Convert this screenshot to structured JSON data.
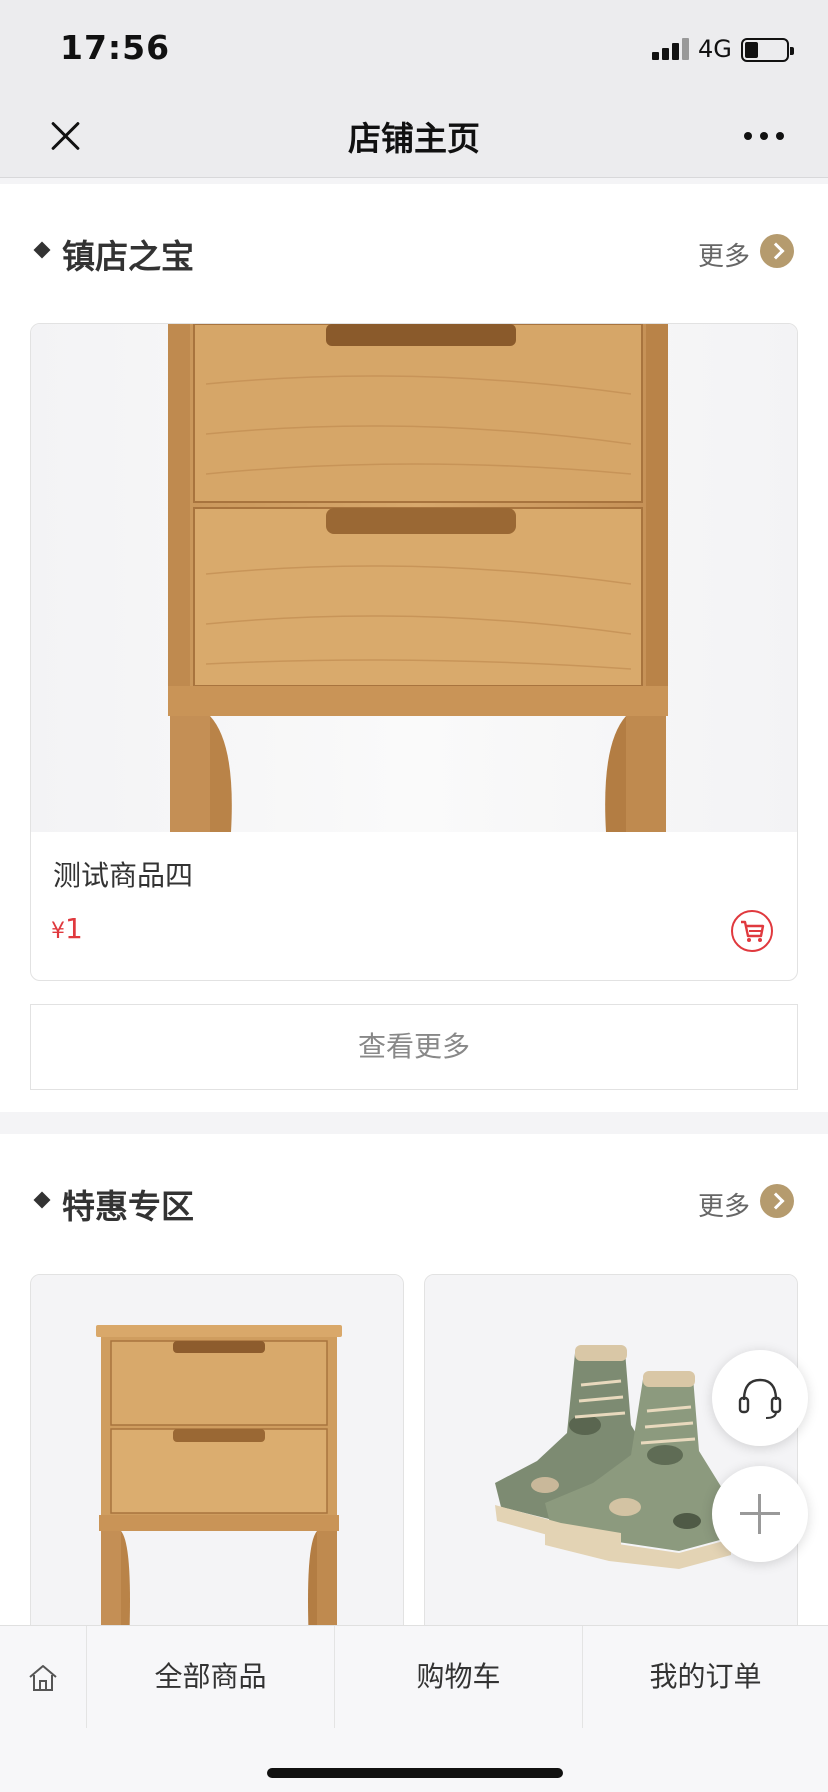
{
  "status_bar": {
    "time": "17:56",
    "network": "4G"
  },
  "nav": {
    "title": "店铺主页"
  },
  "featured": {
    "title": "镇店之宝",
    "more_label": "更多",
    "product": {
      "name": "测试商品四",
      "currency": "¥",
      "price": "1"
    },
    "view_more_label": "查看更多"
  },
  "special": {
    "title": "特惠专区",
    "more_label": "更多"
  },
  "tabbar": {
    "items": [
      {
        "label": "全部商品"
      },
      {
        "label": "购物车"
      },
      {
        "label": "我的订单"
      }
    ]
  },
  "icons": [
    "close-icon",
    "more-icon",
    "arrow-right-icon",
    "cart-icon",
    "customer-service-icon",
    "plus-icon",
    "home-icon"
  ],
  "colors": {
    "price": "#e0393e",
    "accent": "#b59b6e"
  }
}
